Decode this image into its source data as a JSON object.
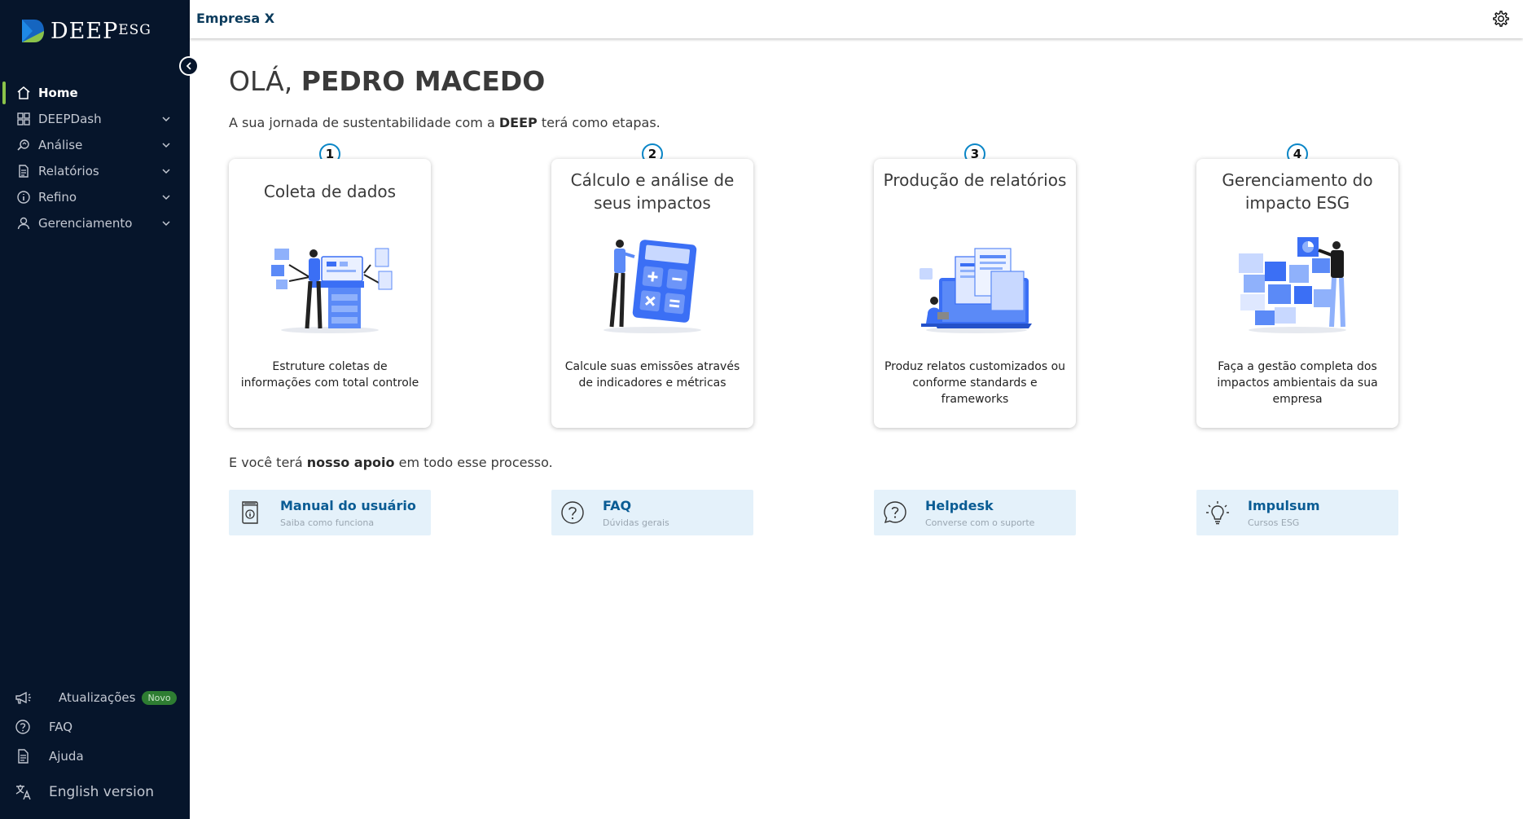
{
  "brand": {
    "name": "DEEP",
    "suffix": "ESG"
  },
  "company": "Empresa X",
  "sidebar": {
    "items": [
      {
        "label": "Home",
        "icon": "home-icon",
        "active": true,
        "expandable": false
      },
      {
        "label": "DEEPDash",
        "icon": "dashboard-icon",
        "active": false,
        "expandable": true
      },
      {
        "label": "Análise",
        "icon": "analysis-icon",
        "active": false,
        "expandable": true
      },
      {
        "label": "Relatórios",
        "icon": "report-icon",
        "active": false,
        "expandable": true
      },
      {
        "label": "Refino",
        "icon": "info-icon",
        "active": false,
        "expandable": true
      },
      {
        "label": "Gerenciamento",
        "icon": "user-icon",
        "active": false,
        "expandable": true
      }
    ],
    "bottom": {
      "updates": {
        "label": "Atualizações",
        "badge": "Novo"
      },
      "faq": "FAQ",
      "help": "Ajuda",
      "language": "English version"
    }
  },
  "greeting": {
    "prefix": "OLÁ,",
    "name": "PEDRO MACEDO"
  },
  "intro": {
    "before": "A sua jornada de sustentabilidade com a",
    "brand": "DEEP",
    "after": "terá como etapas."
  },
  "steps": [
    {
      "number": "1",
      "title": "Coleta de dados",
      "description": "Estruture coletas de informações com total controle",
      "illustration": "data-collection-illustration"
    },
    {
      "number": "2",
      "title": "Cálculo e análise de seus impactos",
      "description": "Calcule suas emissões através de indicadores e métricas",
      "illustration": "calculator-illustration"
    },
    {
      "number": "3",
      "title": "Produção de relatórios",
      "description": "Produz relatos customizados ou conforme standards e frameworks",
      "illustration": "reports-illustration"
    },
    {
      "number": "4",
      "title": "Gerenciamento do impacto ESG",
      "description": "Faça a gestão completa dos impactos ambientais da sua empresa",
      "illustration": "management-illustration"
    }
  ],
  "support": {
    "text_before": "E você terá",
    "text_bold": "nosso apoio",
    "text_after": "em todo esse processo.",
    "cards": [
      {
        "title": "Manual do usuário",
        "subtitle": "Saiba como funciona",
        "icon": "manual-icon"
      },
      {
        "title": "FAQ",
        "subtitle": "Dúvidas gerais",
        "icon": "question-icon"
      },
      {
        "title": "Helpdesk",
        "subtitle": "Converse com o suporte",
        "icon": "chat-question-icon"
      },
      {
        "title": "Impulsum",
        "subtitle": "Cursos ESG",
        "icon": "lightbulb-icon"
      }
    ]
  },
  "colors": {
    "sidebar_bg": "#06152b",
    "active_accent": "#8bc34a",
    "step_ring": "#0a86c7",
    "support_bg": "#e4f1fa",
    "support_title": "#0a5c94",
    "badge_bg": "#2e7d32"
  }
}
